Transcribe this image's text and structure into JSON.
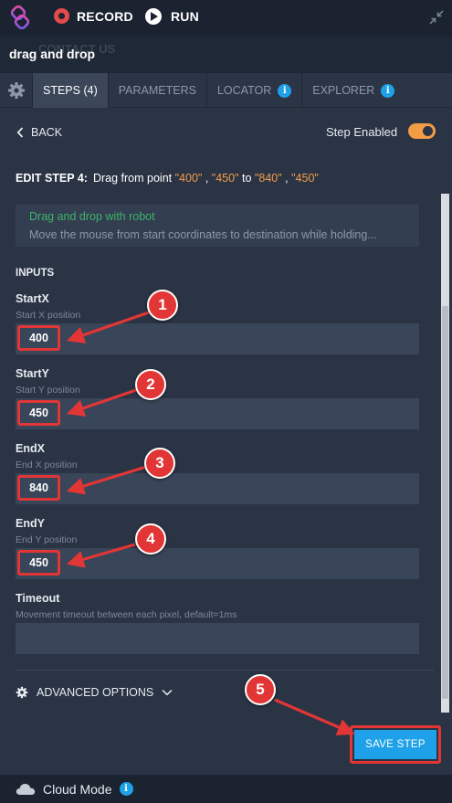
{
  "toolbar": {
    "record_label": "RECORD",
    "run_label": "RUN"
  },
  "background_ghost": {
    "contact_text": "CONTACT US"
  },
  "window": {
    "title": "drag and drop"
  },
  "tabs": [
    {
      "label": "STEPS (4)",
      "active": true
    },
    {
      "label": "PARAMETERS",
      "active": false
    },
    {
      "label": "LOCATOR",
      "active": false,
      "info": true
    },
    {
      "label": "EXPLORER",
      "active": false,
      "info": true
    }
  ],
  "step": {
    "back_label": "BACK",
    "enabled_label": "Step Enabled",
    "enabled": true,
    "edit_prefix": "EDIT STEP 4:",
    "edit_text_1": "Drag from point",
    "edit_v1": "\"400\"",
    "edit_sep": ",",
    "edit_v2": "\"450\"",
    "edit_to": "to",
    "edit_v3": "\"840\"",
    "edit_v4": "\"450\"",
    "description_title": "Drag and drop with robot",
    "description_text": "Move the mouse from start coordinates to destination while holding..."
  },
  "inputs": {
    "heading": "INPUTS",
    "fields": [
      {
        "label": "StartX",
        "sub": "Start X position",
        "value": "400"
      },
      {
        "label": "StartY",
        "sub": "Start Y position",
        "value": "450"
      },
      {
        "label": "EndX",
        "sub": "End X position",
        "value": "840"
      },
      {
        "label": "EndY",
        "sub": "End Y position",
        "value": "450"
      },
      {
        "label": "Timeout",
        "sub": "Movement timeout between each pixel, default=1ms",
        "value": ""
      }
    ]
  },
  "advanced_label": "ADVANCED OPTIONS",
  "save_label": "SAVE STEP",
  "footer": {
    "cloud_label": "Cloud Mode"
  },
  "callouts": [
    "1",
    "2",
    "3",
    "4",
    "5"
  ],
  "colors": {
    "accent": "#1ea1e8",
    "highlight": "#e23636",
    "toggle": "#f39c46",
    "success": "#3cb46a"
  }
}
